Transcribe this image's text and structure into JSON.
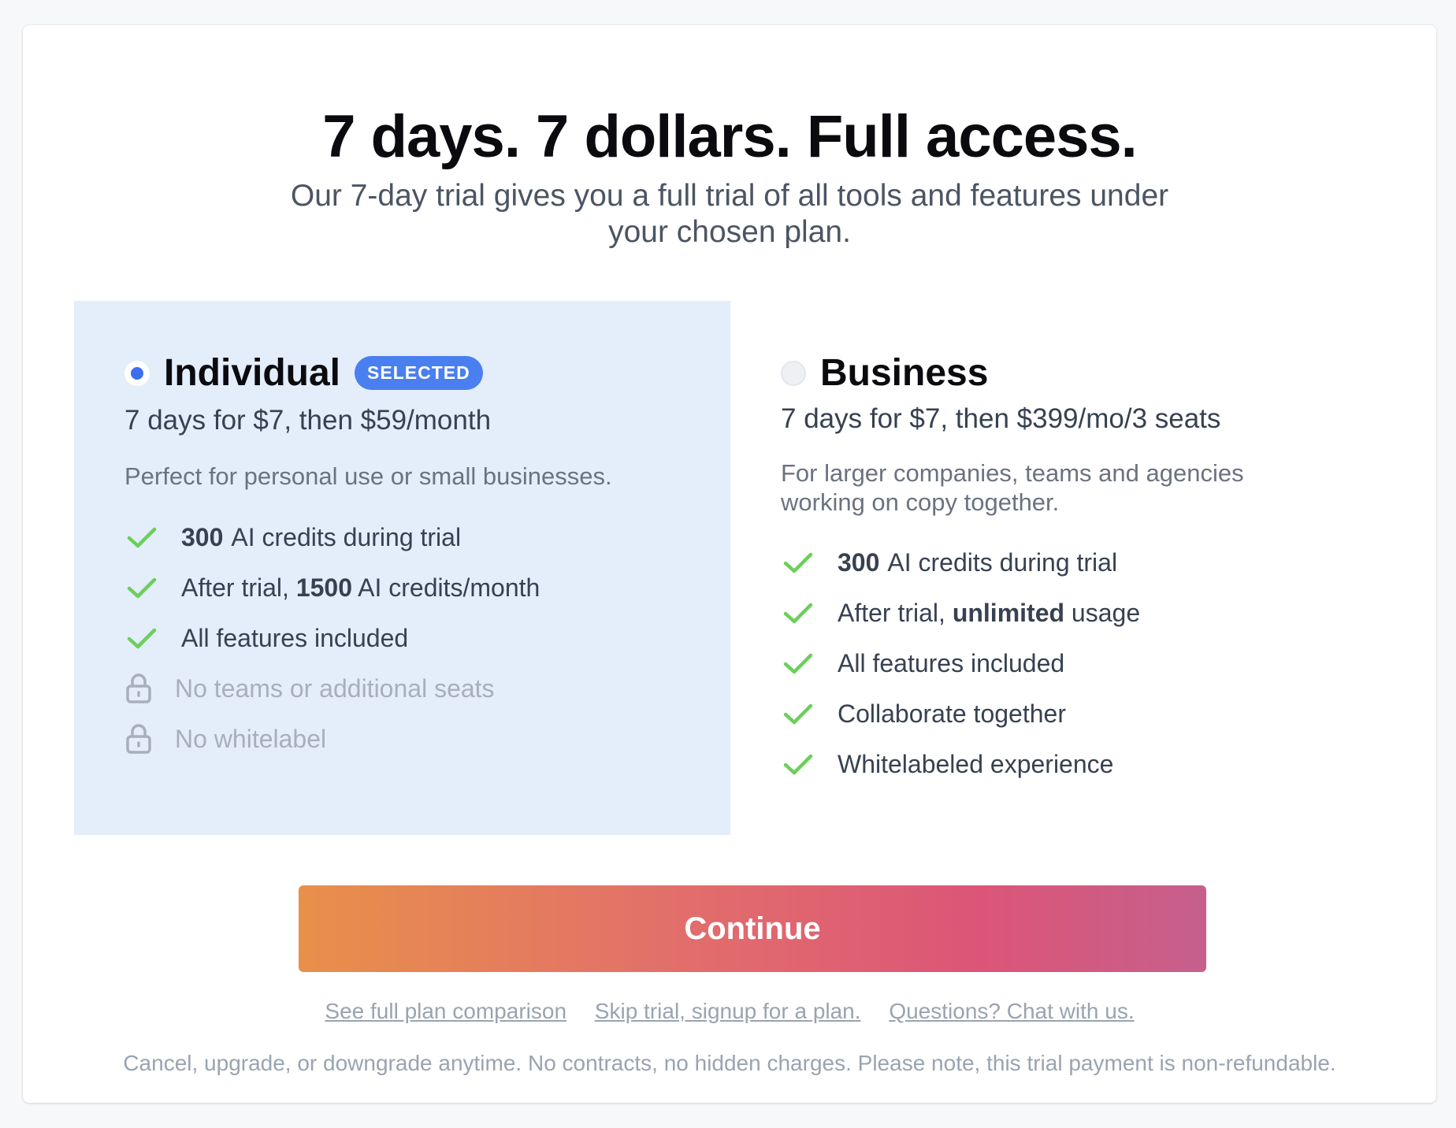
{
  "header": {
    "title": "7 days. 7 dollars. Full access.",
    "subtitle": "Our 7-day trial gives you a full trial of all tools and features under your chosen plan."
  },
  "plans": {
    "individual": {
      "name": "Individual",
      "badge": "SELECTED",
      "selected": true,
      "price": "7 days for $7, then $59/month",
      "description": "Perfect for personal use or small businesses.",
      "features": {
        "f1_bold": "300",
        "f1_text": " AI credits during trial",
        "f2_pre": "After trial, ",
        "f2_bold": "1500",
        "f2_text": " AI credits/month",
        "f3_text": "All features included",
        "f4_text": "No teams or additional seats",
        "f5_text": "No whitelabel"
      }
    },
    "business": {
      "name": "Business",
      "selected": false,
      "price": "7 days for $7, then $399/mo/3 seats",
      "description": "For larger companies, teams and agencies working on copy together.",
      "features": {
        "f1_bold": "300",
        "f1_text": " AI credits during trial",
        "f2_pre": "After trial, ",
        "f2_bold": "unlimited",
        "f2_text": " usage",
        "f3_text": "All features included",
        "f4_text": "Collaborate together",
        "f5_text": "Whitelabeled experience"
      }
    }
  },
  "actions": {
    "continue_label": "Continue",
    "link_comparison": "See full plan comparison",
    "link_skip": "Skip trial, signup for a plan.",
    "link_chat": "Questions? Chat with us."
  },
  "footnote": "Cancel, upgrade, or downgrade anytime. No contracts, no hidden charges. Please note, this trial payment is non-refundable.",
  "colors": {
    "accent": "#3b6ff0",
    "check": "#6ccf5a",
    "selected_bg": "#e3eefa",
    "gradient_start": "#e8904a",
    "gradient_end": "#c5608c"
  }
}
